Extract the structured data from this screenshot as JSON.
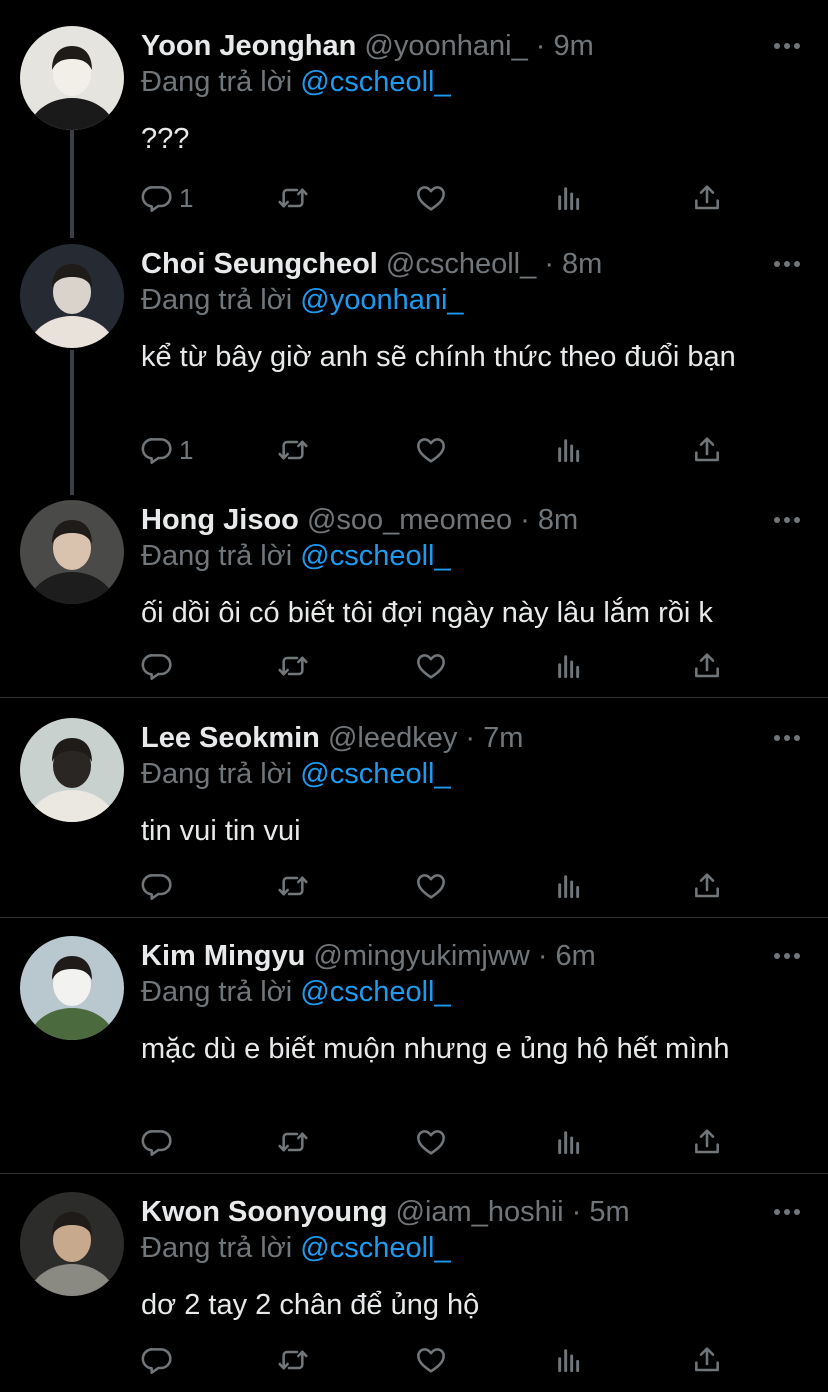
{
  "reply_prefix": "Đang trả lời",
  "tweets": [
    {
      "name": "Yoon Jeonghan",
      "handle": "@yoonhani_",
      "dot": "·",
      "time": "9m",
      "reply_to": "@cscheoll_",
      "text": "???",
      "reply_count": "1",
      "avatar_palette": [
        "#e6e4df",
        "#1a1a1a",
        "#f2efe9"
      ]
    },
    {
      "name": "Choi Seungcheol",
      "handle": "@cscheoll_",
      "dot": "·",
      "time": "8m",
      "reply_to": "@yoonhani_",
      "text": "kể từ bây giờ anh sẽ chính thức theo đuổi bạn",
      "reply_count": "1",
      "avatar_palette": [
        "#262a33",
        "#e8e2da",
        "#d9d3cb"
      ]
    },
    {
      "name": "Hong Jisoo",
      "handle": "@soo_meomeo",
      "dot": "·",
      "time": "8m",
      "reply_to": "@cscheoll_",
      "text": "ối dồi ôi có biết tôi đợi ngày này lâu lắm rồi k",
      "reply_count": "",
      "avatar_palette": [
        "#4a4a48",
        "#1d1d1d",
        "#d9c3ae"
      ]
    },
    {
      "name": "Lee Seokmin",
      "handle": "@leedkey",
      "dot": "·",
      "time": "7m",
      "reply_to": "@cscheoll_",
      "text": "tin vui tin vui",
      "reply_count": "",
      "avatar_palette": [
        "#c9d1cf",
        "#ebe7e1",
        "#2a2624"
      ]
    },
    {
      "name": "Kim Mingyu",
      "handle": "@mingyukimjww",
      "dot": "·",
      "time": "6m",
      "reply_to": "@cscheoll_",
      "text": "mặc dù e biết muộn nhưng e ủng hộ hết mình",
      "reply_count": "",
      "avatar_palette": [
        "#b9c7cf",
        "#4b6a3d",
        "#f2f2f0"
      ]
    },
    {
      "name": "Kwon Soonyoung",
      "handle": "@iam_hoshii",
      "dot": "·",
      "time": "5m",
      "reply_to": "@cscheoll_",
      "text": "dơ 2 tay 2 chân để ủng hộ",
      "reply_count": "",
      "avatar_palette": [
        "#2c2c2a",
        "#8a8a83",
        "#c7a98d"
      ]
    }
  ],
  "icons": {
    "reply": "reply-icon",
    "retweet": "retweet-icon",
    "like": "like-icon",
    "views": "views-icon",
    "share": "share-icon",
    "more": "more-icon"
  },
  "colors": {
    "background": "#000000",
    "text": "#e7e9ea",
    "muted": "#71767b",
    "mention": "#1d9bf0",
    "divider": "#2f3336"
  }
}
